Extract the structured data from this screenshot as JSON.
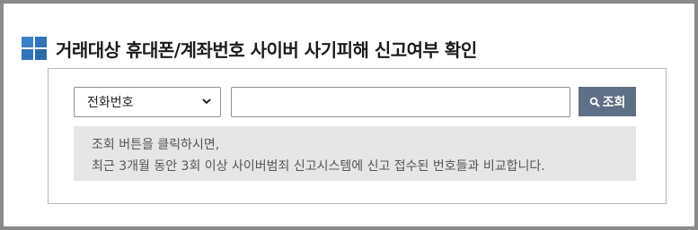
{
  "header": {
    "title": "거래대상 휴대폰/계좌번호 사이버 사기피해 신고여부 확인",
    "logo_icon": "grid-icon",
    "accent_color": "#2f74b8"
  },
  "search": {
    "type_selected": "전화번호",
    "type_options": [
      "전화번호"
    ],
    "input_value": "",
    "input_placeholder": "",
    "button_label": "조회",
    "button_icon": "search-icon",
    "button_color": "#5f6f85"
  },
  "notice": {
    "line1": "조회 버튼을 클릭하시면,",
    "line2": "최근 3개월 동안 3회 이상 사이버범죄 신고시스템에 신고 접수된 번호들과 비교합니다."
  }
}
